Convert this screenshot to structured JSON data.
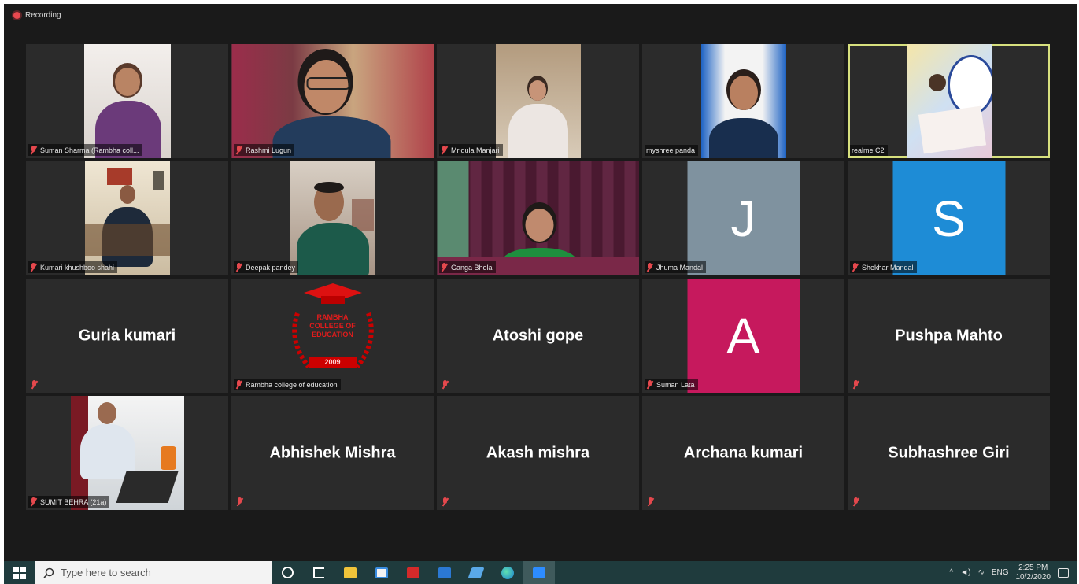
{
  "recording": {
    "label": "Recording"
  },
  "grid": {
    "row1": [
      {
        "name": "Suman Sharma (Rambha coll...",
        "video": true
      },
      {
        "name": "Rashmi Lugun",
        "video": true
      },
      {
        "name": "Mridula Manjari",
        "video": true
      },
      {
        "name": "myshree panda",
        "video": true
      },
      {
        "name": "realme C2",
        "video": true,
        "active": true
      }
    ],
    "row2": [
      {
        "name": "Kumari khushboo shahi",
        "video": true
      },
      {
        "name": "Deepak pandey",
        "video": true
      },
      {
        "name": "Ganga Bhola",
        "video": true
      },
      {
        "name": "Jhuma Mandal",
        "avatar_letter": "J",
        "avatar_color": "#7f929f"
      },
      {
        "name": "Shekhar Mandal",
        "avatar_letter": "S",
        "avatar_color": "#1e8cd6"
      }
    ],
    "row3": [
      {
        "name": "Guria kumari",
        "name_only": true
      },
      {
        "name": "Rambha college of education",
        "logo_lines": [
          "RAMBHA",
          "COLLEGE OF",
          "EDUCATION"
        ],
        "logo_year": "2009"
      },
      {
        "name": "Atoshi gope",
        "name_only": true
      },
      {
        "name": "Suman Lata",
        "avatar_letter": "A",
        "avatar_color": "#c6195d"
      },
      {
        "name": "Pushpa Mahto",
        "name_only": true
      }
    ],
    "row4": [
      {
        "name": "SUMIT BEHRA (21a)",
        "video": true
      },
      {
        "name": "Abhishek Mishra",
        "name_only": true
      },
      {
        "name": "Akash mishra",
        "name_only": true
      },
      {
        "name": "Archana kumari",
        "name_only": true
      },
      {
        "name": "Subhashree Giri",
        "name_only": true
      }
    ]
  },
  "taskbar": {
    "search_placeholder": "Type here to search",
    "language": "ENG",
    "time": "2:25 PM",
    "date": "10/2/2020"
  },
  "colors": {
    "accent_active": "#d7e07e",
    "muted_mic": "#e5484d",
    "taskbar": "#1f3b3d"
  }
}
